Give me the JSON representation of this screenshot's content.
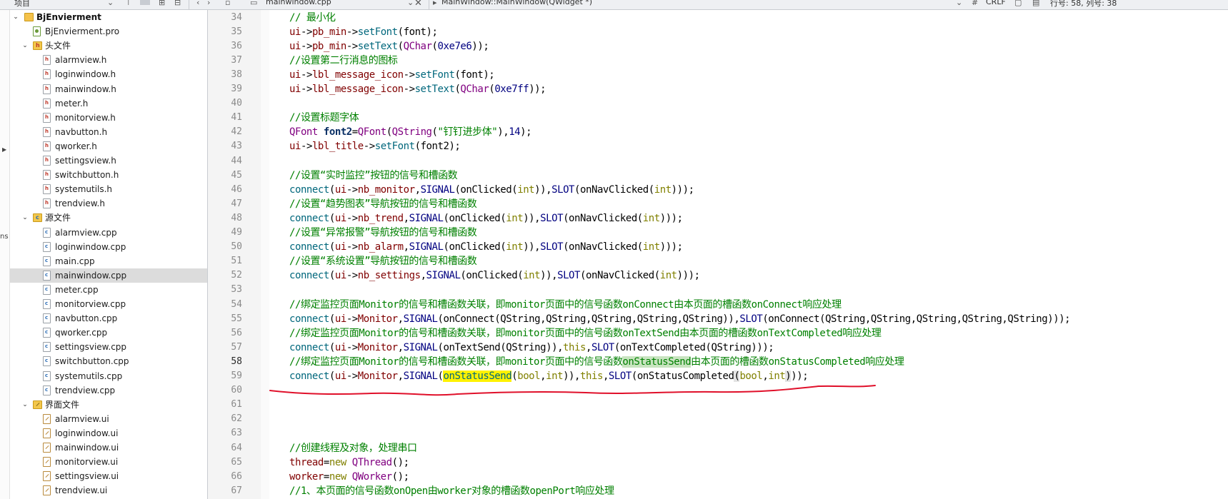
{
  "window": {
    "tree_header": "项目",
    "editor_tab": "mainwindow.cpp",
    "symbol_scope": "MainWindow::MainWindow(QWidget *)",
    "line_ending": "CRLF",
    "cursor_position": "行号: 58, 列号: 38"
  },
  "left_strip": {
    "partial_text": "ns"
  },
  "tree": [
    {
      "label": "BjEnvierment",
      "depth": 0,
      "kind": "project",
      "expanded": true
    },
    {
      "label": "BjEnvierment.pro",
      "depth": 1,
      "kind": "pro"
    },
    {
      "label": "头文件",
      "depth": 1,
      "kind": "folder-h",
      "expanded": true
    },
    {
      "label": "alarmview.h",
      "depth": 2,
      "kind": "h"
    },
    {
      "label": "loginwindow.h",
      "depth": 2,
      "kind": "h"
    },
    {
      "label": "mainwindow.h",
      "depth": 2,
      "kind": "h"
    },
    {
      "label": "meter.h",
      "depth": 2,
      "kind": "h"
    },
    {
      "label": "monitorview.h",
      "depth": 2,
      "kind": "h"
    },
    {
      "label": "navbutton.h",
      "depth": 2,
      "kind": "h"
    },
    {
      "label": "qworker.h",
      "depth": 2,
      "kind": "h"
    },
    {
      "label": "settingsview.h",
      "depth": 2,
      "kind": "h"
    },
    {
      "label": "switchbutton.h",
      "depth": 2,
      "kind": "h"
    },
    {
      "label": "systemutils.h",
      "depth": 2,
      "kind": "h"
    },
    {
      "label": "trendview.h",
      "depth": 2,
      "kind": "h"
    },
    {
      "label": "源文件",
      "depth": 1,
      "kind": "folder-c",
      "expanded": true
    },
    {
      "label": "alarmview.cpp",
      "depth": 2,
      "kind": "c"
    },
    {
      "label": "loginwindow.cpp",
      "depth": 2,
      "kind": "c"
    },
    {
      "label": "main.cpp",
      "depth": 2,
      "kind": "c"
    },
    {
      "label": "mainwindow.cpp",
      "depth": 2,
      "kind": "c",
      "selected": true
    },
    {
      "label": "meter.cpp",
      "depth": 2,
      "kind": "c"
    },
    {
      "label": "monitorview.cpp",
      "depth": 2,
      "kind": "c"
    },
    {
      "label": "navbutton.cpp",
      "depth": 2,
      "kind": "c"
    },
    {
      "label": "qworker.cpp",
      "depth": 2,
      "kind": "c"
    },
    {
      "label": "settingsview.cpp",
      "depth": 2,
      "kind": "c"
    },
    {
      "label": "switchbutton.cpp",
      "depth": 2,
      "kind": "c"
    },
    {
      "label": "systemutils.cpp",
      "depth": 2,
      "kind": "c"
    },
    {
      "label": "trendview.cpp",
      "depth": 2,
      "kind": "c"
    },
    {
      "label": "界面文件",
      "depth": 1,
      "kind": "folder-ui",
      "expanded": true
    },
    {
      "label": "alarmview.ui",
      "depth": 2,
      "kind": "ui"
    },
    {
      "label": "loginwindow.ui",
      "depth": 2,
      "kind": "ui"
    },
    {
      "label": "mainwindow.ui",
      "depth": 2,
      "kind": "ui"
    },
    {
      "label": "monitorview.ui",
      "depth": 2,
      "kind": "ui"
    },
    {
      "label": "settingsview.ui",
      "depth": 2,
      "kind": "ui"
    },
    {
      "label": "trendview.ui",
      "depth": 2,
      "kind": "ui"
    }
  ],
  "editor": {
    "current_line": 58,
    "lines": [
      {
        "n": 34,
        "t": [
          [
            "c",
            "// 最小化"
          ]
        ]
      },
      {
        "n": 35,
        "t": [
          [
            "m",
            "ui"
          ],
          [
            "",
            "->"
          ],
          [
            "m",
            "pb_min"
          ],
          [
            "",
            "->"
          ],
          [
            "f",
            "setFont"
          ],
          [
            "",
            "(font);"
          ]
        ]
      },
      {
        "n": 36,
        "t": [
          [
            "m",
            "ui"
          ],
          [
            "",
            "->"
          ],
          [
            "m",
            "pb_min"
          ],
          [
            "",
            "->"
          ],
          [
            "f",
            "setText"
          ],
          [
            "",
            "("
          ],
          [
            "t",
            "QChar"
          ],
          [
            "",
            "("
          ],
          [
            "n",
            "0xe7e6"
          ],
          [
            "",
            "));"
          ]
        ]
      },
      {
        "n": 37,
        "t": [
          [
            "c",
            "//设置第二行消息的图标"
          ]
        ]
      },
      {
        "n": 38,
        "t": [
          [
            "m",
            "ui"
          ],
          [
            "",
            "->"
          ],
          [
            "m",
            "lbl_message_icon"
          ],
          [
            "",
            "->"
          ],
          [
            "f",
            "setFont"
          ],
          [
            "",
            "(font);"
          ]
        ]
      },
      {
        "n": 39,
        "t": [
          [
            "m",
            "ui"
          ],
          [
            "",
            "->"
          ],
          [
            "m",
            "lbl_message_icon"
          ],
          [
            "",
            "->"
          ],
          [
            "f",
            "setText"
          ],
          [
            "",
            "("
          ],
          [
            "t",
            "QChar"
          ],
          [
            "",
            "("
          ],
          [
            "n",
            "0xe7ff"
          ],
          [
            "",
            "));"
          ]
        ]
      },
      {
        "n": 40,
        "t": []
      },
      {
        "n": 41,
        "t": [
          [
            "c",
            "//设置标题字体"
          ]
        ]
      },
      {
        "n": 42,
        "t": [
          [
            "t",
            "QFont"
          ],
          [
            "",
            " "
          ],
          [
            "b",
            "font2"
          ],
          [
            "",
            "="
          ],
          [
            "t",
            "QFont"
          ],
          [
            "",
            "("
          ],
          [
            "t",
            "QString"
          ],
          [
            "",
            "("
          ],
          [
            "s",
            "\"钉钉进步体\""
          ],
          [
            "",
            ")"
          ],
          [
            "",
            ","
          ],
          [
            "n",
            "14"
          ],
          [
            "",
            ");"
          ]
        ]
      },
      {
        "n": 43,
        "t": [
          [
            "m",
            "ui"
          ],
          [
            "",
            "->"
          ],
          [
            "m",
            "lbl_title"
          ],
          [
            "",
            "->"
          ],
          [
            "f",
            "setFont"
          ],
          [
            "",
            "(font2);"
          ]
        ]
      },
      {
        "n": 44,
        "t": []
      },
      {
        "n": 45,
        "t": [
          [
            "c",
            "//设置“实时监控”按钮的信号和槽函数"
          ]
        ]
      },
      {
        "n": 46,
        "t": [
          [
            "f",
            "connect"
          ],
          [
            "",
            "("
          ],
          [
            "m",
            "ui"
          ],
          [
            "",
            "->"
          ],
          [
            "m",
            "nb_monitor"
          ],
          [
            "",
            ","
          ],
          [
            "a",
            "SIGNAL"
          ],
          [
            "",
            "(onClicked("
          ],
          [
            "k",
            "int"
          ],
          [
            "",
            "))"
          ],
          [
            "",
            ","
          ],
          [
            "a",
            "SLOT"
          ],
          [
            "",
            "(onNavClicked("
          ],
          [
            "k",
            "int"
          ],
          [
            "",
            ")));"
          ]
        ]
      },
      {
        "n": 47,
        "t": [
          [
            "c",
            "//设置“趋势图表”导航按钮的信号和槽函数"
          ]
        ]
      },
      {
        "n": 48,
        "t": [
          [
            "f",
            "connect"
          ],
          [
            "",
            "("
          ],
          [
            "m",
            "ui"
          ],
          [
            "",
            "->"
          ],
          [
            "m",
            "nb_trend"
          ],
          [
            "",
            ","
          ],
          [
            "a",
            "SIGNAL"
          ],
          [
            "",
            "(onClicked("
          ],
          [
            "k",
            "int"
          ],
          [
            "",
            "))"
          ],
          [
            "",
            ","
          ],
          [
            "a",
            "SLOT"
          ],
          [
            "",
            "(onNavClicked("
          ],
          [
            "k",
            "int"
          ],
          [
            "",
            ")));"
          ]
        ]
      },
      {
        "n": 49,
        "t": [
          [
            "c",
            "//设置“异常报警”导航按钮的信号和槽函数"
          ]
        ]
      },
      {
        "n": 50,
        "t": [
          [
            "f",
            "connect"
          ],
          [
            "",
            "("
          ],
          [
            "m",
            "ui"
          ],
          [
            "",
            "->"
          ],
          [
            "m",
            "nb_alarm"
          ],
          [
            "",
            ","
          ],
          [
            "a",
            "SIGNAL"
          ],
          [
            "",
            "(onClicked("
          ],
          [
            "k",
            "int"
          ],
          [
            "",
            "))"
          ],
          [
            "",
            ","
          ],
          [
            "a",
            "SLOT"
          ],
          [
            "",
            "(onNavClicked("
          ],
          [
            "k",
            "int"
          ],
          [
            "",
            ")));"
          ]
        ]
      },
      {
        "n": 51,
        "t": [
          [
            "c",
            "//设置“系统设置”导航按钮的信号和槽函数"
          ]
        ]
      },
      {
        "n": 52,
        "t": [
          [
            "f",
            "connect"
          ],
          [
            "",
            "("
          ],
          [
            "m",
            "ui"
          ],
          [
            "",
            "->"
          ],
          [
            "m",
            "nb_settings"
          ],
          [
            "",
            ","
          ],
          [
            "a",
            "SIGNAL"
          ],
          [
            "",
            "(onClicked("
          ],
          [
            "k",
            "int"
          ],
          [
            "",
            "))"
          ],
          [
            "",
            ","
          ],
          [
            "a",
            "SLOT"
          ],
          [
            "",
            "(onNavClicked("
          ],
          [
            "k",
            "int"
          ],
          [
            "",
            ")));"
          ]
        ]
      },
      {
        "n": 53,
        "t": []
      },
      {
        "n": 54,
        "t": [
          [
            "c",
            "//绑定监控页面Monitor的信号和槽函数关联，即monitor页面中的信号函数onConnect由本页面的槽函数onConnect响应处理"
          ]
        ]
      },
      {
        "n": 55,
        "t": [
          [
            "f",
            "connect"
          ],
          [
            "",
            "("
          ],
          [
            "m",
            "ui"
          ],
          [
            "",
            "->"
          ],
          [
            "m",
            "Monitor"
          ],
          [
            "",
            ","
          ],
          [
            "a",
            "SIGNAL"
          ],
          [
            "",
            "(onConnect(QString,QString,QString,QString,QString))"
          ],
          [
            "",
            ","
          ],
          [
            "a",
            "SLOT"
          ],
          [
            "",
            "(onConnect(QString,QString,QString,QString,QString)));"
          ]
        ]
      },
      {
        "n": 56,
        "t": [
          [
            "c",
            "//绑定监控页面Monitor的信号和槽函数关联，即monitor页面中的信号函数onTextSend由本页面的槽函数onTextCompleted响应处理"
          ]
        ]
      },
      {
        "n": 57,
        "t": [
          [
            "f",
            "connect"
          ],
          [
            "",
            "("
          ],
          [
            "m",
            "ui"
          ],
          [
            "",
            "->"
          ],
          [
            "m",
            "Monitor"
          ],
          [
            "",
            ","
          ],
          [
            "a",
            "SIGNAL"
          ],
          [
            "",
            "(onTextSend(QString))"
          ],
          [
            "",
            ","
          ],
          [
            "k",
            "this"
          ],
          [
            "",
            ","
          ],
          [
            "a",
            "SLOT"
          ],
          [
            "",
            "(onTextCompleted(QString)));"
          ]
        ]
      },
      {
        "n": 58,
        "t": [
          [
            "c",
            "//绑定监控页面Monitor的信号和槽函数关联，即monitor页面中的信号函数"
          ],
          [
            "cg",
            "onStatusSend"
          ],
          [
            "c",
            "由本页面的槽函数onStatusCompleted响应处理"
          ]
        ]
      },
      {
        "n": 59,
        "t": [
          [
            "f",
            "connect"
          ],
          [
            "",
            "("
          ],
          [
            "m",
            "ui"
          ],
          [
            "",
            "->"
          ],
          [
            "m",
            "Monitor"
          ],
          [
            "",
            ","
          ],
          [
            "a",
            "SIGNAL"
          ],
          [
            "",
            "("
          ],
          [
            "y",
            "onStatusSend"
          ],
          [
            "",
            "("
          ],
          [
            "k",
            "bool"
          ],
          [
            "",
            ","
          ],
          [
            "k",
            "int"
          ],
          [
            "",
            "))"
          ],
          [
            "",
            ","
          ],
          [
            "k",
            "this"
          ],
          [
            "",
            ","
          ],
          [
            "a",
            "SLOT"
          ],
          [
            "",
            "(onStatusCompleted"
          ],
          [
            "p",
            "("
          ],
          [
            "k",
            "bool"
          ],
          [
            "",
            ","
          ],
          [
            "k",
            "int"
          ],
          [
            "p",
            ")"
          ],
          [
            "",
            "));"
          ]
        ]
      },
      {
        "n": 60,
        "t": []
      },
      {
        "n": 61,
        "t": []
      },
      {
        "n": 62,
        "t": []
      },
      {
        "n": 63,
        "t": []
      },
      {
        "n": 64,
        "t": [
          [
            "c",
            "//创建线程及对象，处理串口"
          ]
        ]
      },
      {
        "n": 65,
        "t": [
          [
            "m",
            "thread"
          ],
          [
            "",
            "="
          ],
          [
            "k",
            "new"
          ],
          [
            "",
            " "
          ],
          [
            "t",
            "QThread"
          ],
          [
            "",
            "();"
          ]
        ]
      },
      {
        "n": 66,
        "t": [
          [
            "m",
            "worker"
          ],
          [
            "",
            "="
          ],
          [
            "k",
            "new"
          ],
          [
            "",
            " "
          ],
          [
            "t",
            "QWorker"
          ],
          [
            "",
            "();"
          ]
        ]
      },
      {
        "n": 67,
        "t": [
          [
            "c",
            "//1、本页面的信号函数onOpen由worker对象的槽函数openPort响应处理"
          ]
        ]
      }
    ]
  },
  "colors": {
    "comment": "#008000",
    "keyword": "#808000",
    "type": "#800080",
    "function": "#00677c",
    "member": "#800000",
    "macro": "#000080",
    "highlight": "#fff200",
    "annotation": "#e0102a"
  }
}
